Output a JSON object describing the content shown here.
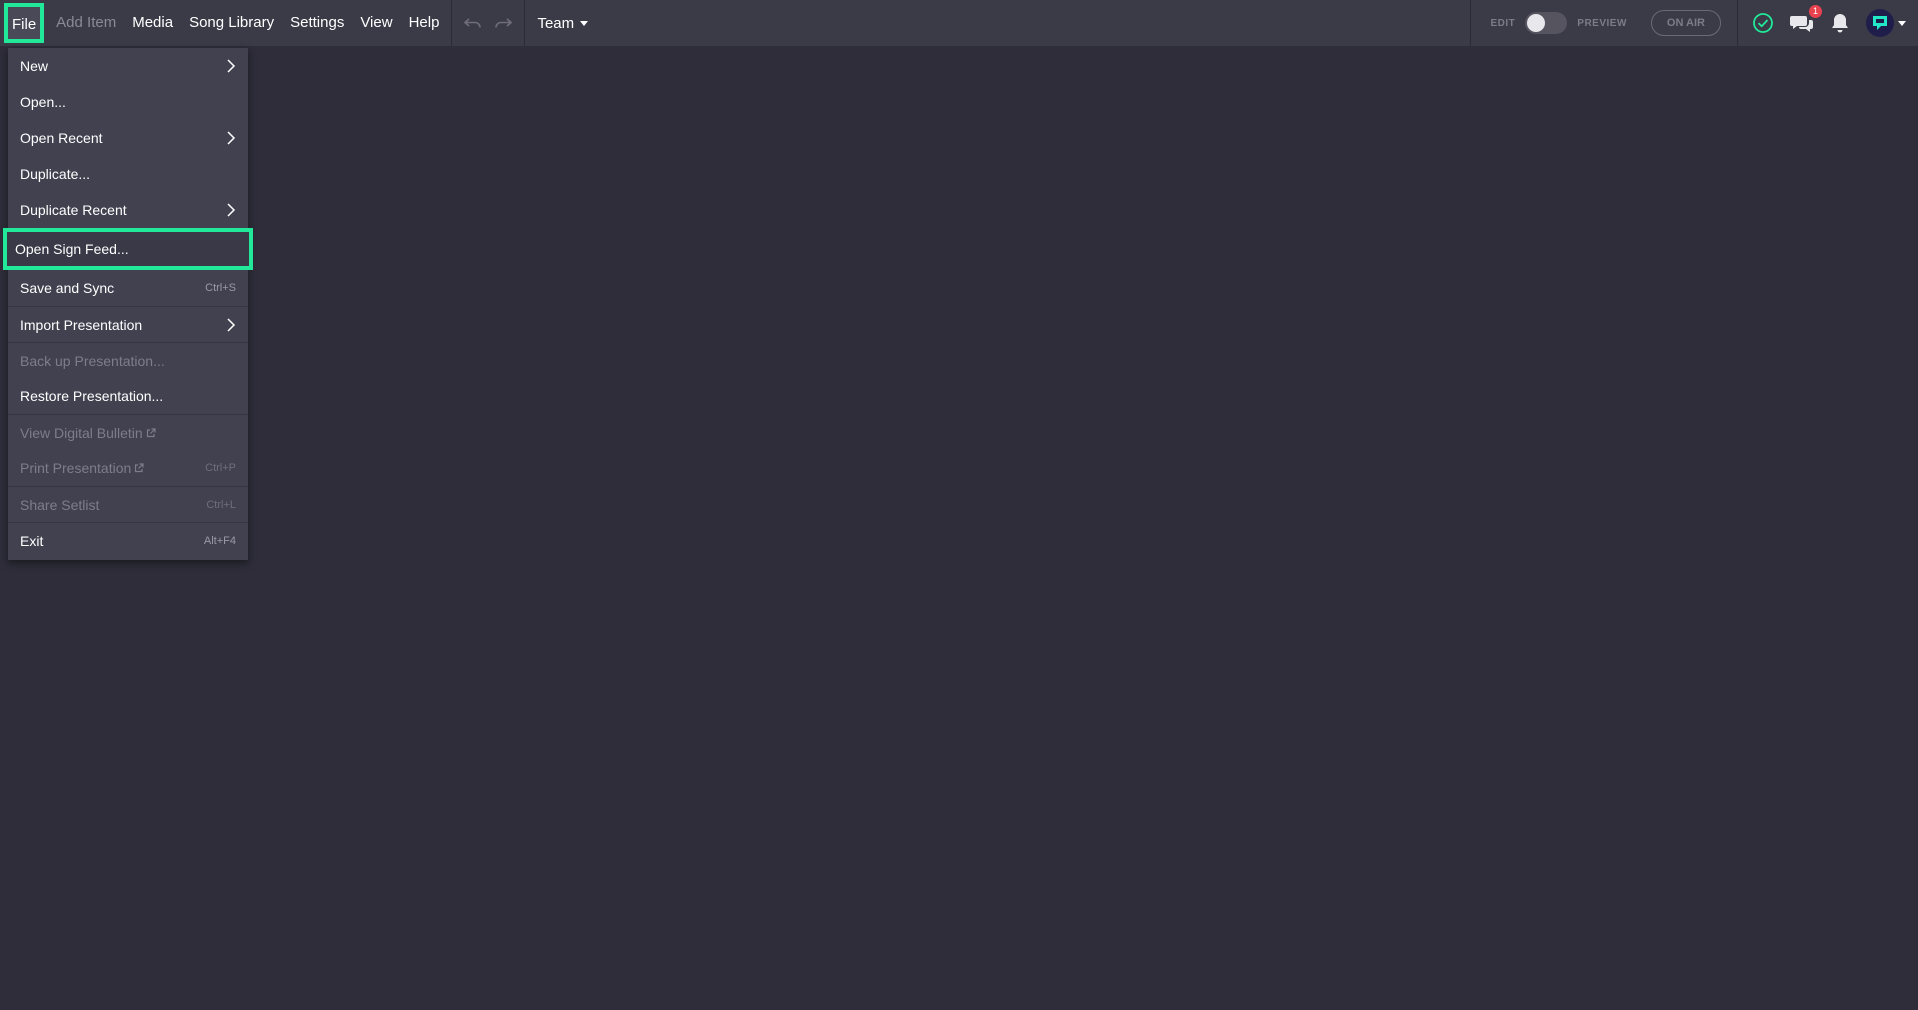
{
  "menubar": {
    "file": "File",
    "add_item": "Add Item",
    "media": "Media",
    "song_library": "Song Library",
    "settings": "Settings",
    "view": "View",
    "help": "Help",
    "team": "Team"
  },
  "mode": {
    "edit": "EDIT",
    "preview": "PREVIEW",
    "on_air": "ON AIR"
  },
  "notifications": {
    "chat_badge": "1"
  },
  "file_menu": {
    "new": "New",
    "open": "Open...",
    "open_recent": "Open Recent",
    "duplicate": "Duplicate...",
    "duplicate_recent": "Duplicate Recent",
    "open_sign_feed": "Open Sign Feed...",
    "save_sync": "Save and Sync",
    "save_sync_shortcut": "Ctrl+S",
    "import_presentation": "Import Presentation",
    "back_up": "Back up Presentation...",
    "restore": "Restore Presentation...",
    "view_bulletin": "View Digital Bulletin",
    "print": "Print Presentation",
    "print_shortcut": "Ctrl+P",
    "share_setlist": "Share Setlist",
    "share_shortcut": "Ctrl+L",
    "exit": "Exit",
    "exit_shortcut": "Alt+F4"
  },
  "colors": {
    "accent": "#22e89a",
    "background": "#2e2d39",
    "topbar": "#3b3a47",
    "menu": "#424150",
    "badge": "#e8424f"
  }
}
